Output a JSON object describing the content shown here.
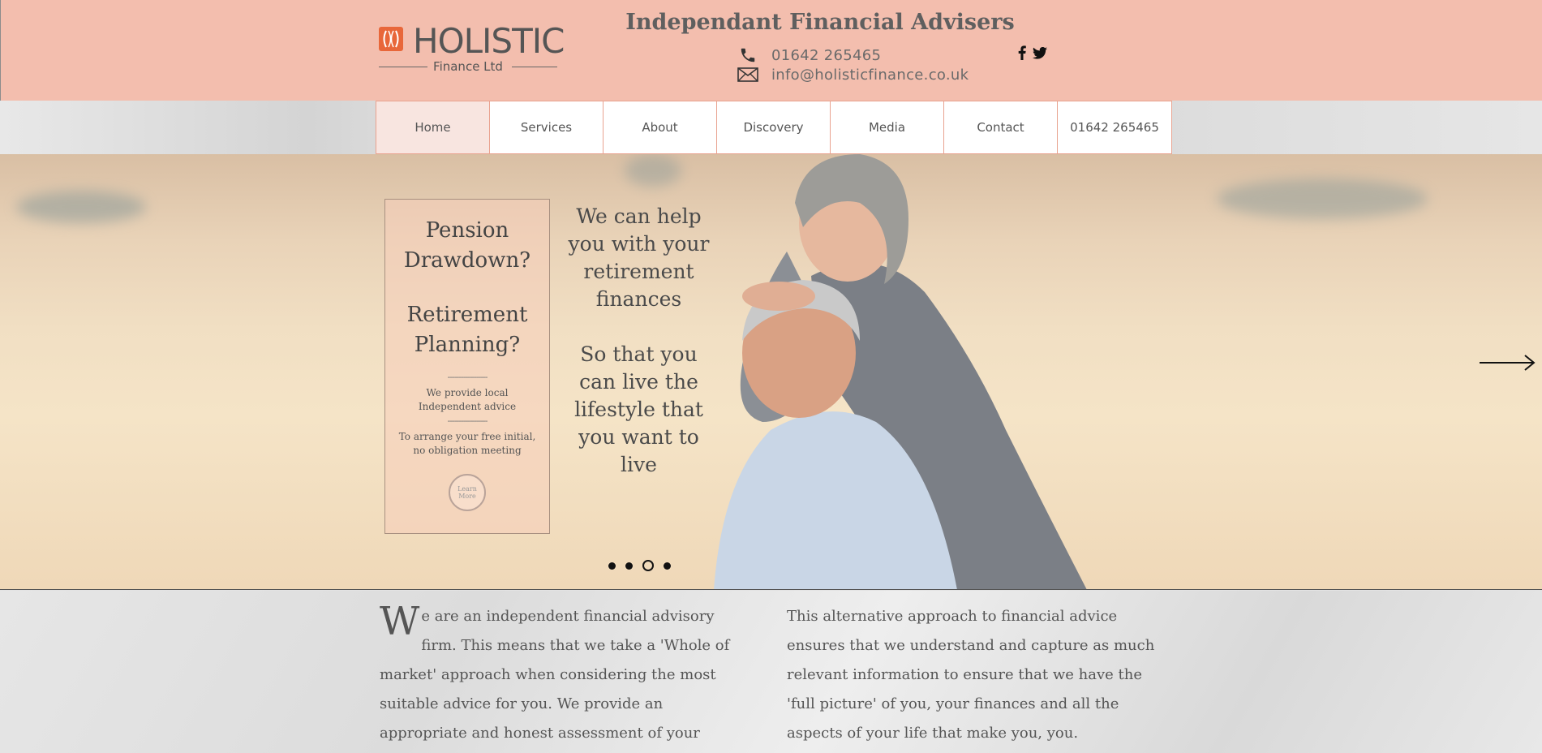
{
  "header": {
    "logo": {
      "word": "HOLISTIC",
      "sub": "Finance Ltd"
    },
    "tagline": "Independant Financial Advisers",
    "phone": "01642 265465",
    "email": "info@holisticfinance.co.uk",
    "social": [
      "facebook-icon",
      "twitter-icon"
    ]
  },
  "nav": {
    "items": [
      "Home",
      "Services",
      "About",
      "Discovery",
      "Media",
      "Contact",
      "01642 265465"
    ],
    "active": "Home"
  },
  "hero": {
    "box": {
      "heading1": "Pension Drawdown?",
      "heading2": "Retirement Planning?",
      "dashes": "------------------",
      "line1": "We provide local Independent advice",
      "line2": "To arrange your free initial, no obligation meeting",
      "button": "Learn More"
    },
    "text1": "We can help you with your retirement finances",
    "text2": "So that you can live the lifestyle that you want to live",
    "slides": 4,
    "active_slide": 3
  },
  "content": {
    "col1_cap": "W",
    "col1": "e are an independent financial advisory firm. This means that we take a 'Whole of market' approach when considering the most suitable advice for you. We provide an appropriate and honest assessment of your financial circumstance",
    "col2": "This alternative approach to financial advice ensures that we understand and capture as much relevant information to ensure that we have the 'full picture' of you, your finances and all the aspects of your life that make you, you."
  },
  "colors": {
    "header_bg": "#f3beae",
    "nav_border": "#e9a390",
    "active_nav": "#f8e5e0",
    "logo_mark": "#e8673a"
  }
}
